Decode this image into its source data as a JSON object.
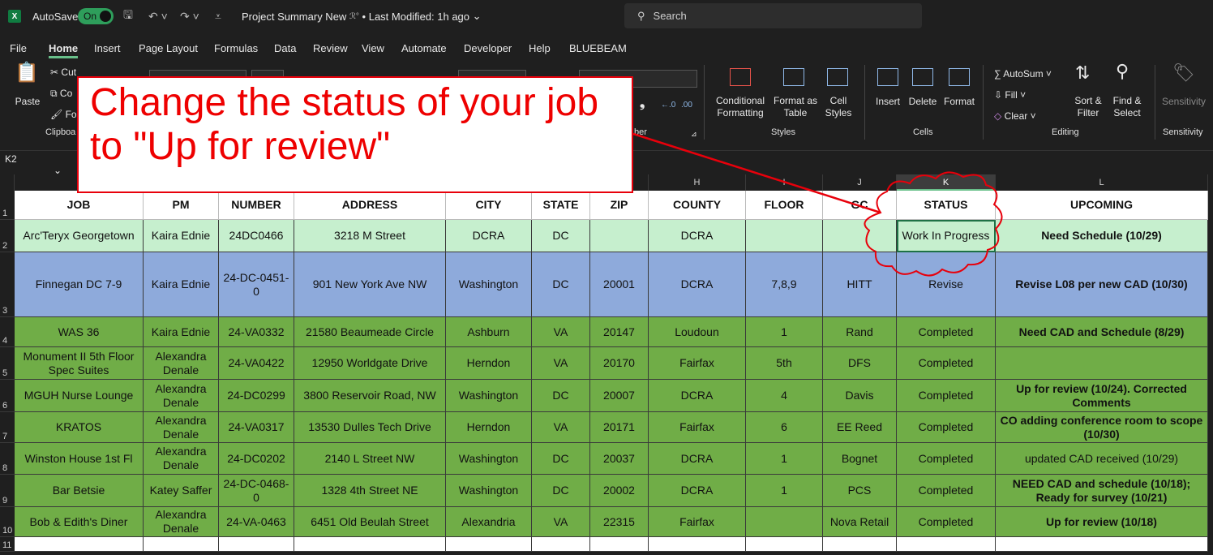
{
  "titlebar": {
    "app_icon": "X",
    "autosave_label": "AutoSave",
    "autosave_state": "On",
    "doc_title": "Project Summary New",
    "doc_meta": "• Last Modified: 1h ago",
    "search_placeholder": "Search"
  },
  "menu": [
    "File",
    "Home",
    "Insert",
    "Page Layout",
    "Formulas",
    "Data",
    "Review",
    "View",
    "Automate",
    "Developer",
    "Help",
    "BLUEBEAM"
  ],
  "ribbon": {
    "clipboard": {
      "paste": "Paste",
      "cut": "Cut",
      "copy": "Co",
      "format": "Fo",
      "group": "Clipboa"
    },
    "number_group": "ber",
    "styles": {
      "conditional": "Conditional\nFormatting",
      "format_table": "Format as\nTable",
      "cell_styles": "Cell\nStyles",
      "group": "Styles"
    },
    "cells": {
      "insert": "Insert",
      "delete": "Delete",
      "format": "Format",
      "group": "Cells"
    },
    "editing": {
      "autosum": "AutoSum",
      "fill": "Fill",
      "clear": "Clear",
      "sort": "Sort &\nFilter",
      "find": "Find &\nSelect",
      "group": "Editing"
    },
    "sensitivity": {
      "label": "Sensitivity",
      "group": "Sensitivity"
    }
  },
  "namebox": "K2",
  "colors": {
    "light_green": "#c6efce",
    "blue": "#8eaadb",
    "green": "#70ad47",
    "header": "#ffffff",
    "accent": "#69c08a",
    "callout_red": "#ee0000"
  },
  "sheet": {
    "col_letters": [
      "",
      "",
      "",
      "",
      "",
      "",
      "",
      "H",
      "I",
      "J",
      "K",
      "L"
    ],
    "headers": [
      "JOB",
      "PM",
      "NUMBER",
      "ADDRESS",
      "CITY",
      "STATE",
      "ZIP",
      "COUNTY",
      "FLOOR",
      "GC",
      "STATUS",
      "UPCOMING"
    ],
    "rows": [
      [
        "Arc'Teryx Georgetown",
        "Kaira Ednie",
        "24DC0466",
        "3218 M Street",
        "DCRA",
        "DC",
        "",
        "DCRA",
        "",
        "",
        "Work In Progress",
        "Need Schedule (10/29)"
      ],
      [
        "Finnegan DC 7-9",
        "Kaira Ednie",
        "24-DC-0451-0",
        "901 New York Ave NW",
        "Washington",
        "DC",
        "20001",
        "DCRA",
        "7,8,9",
        "HITT",
        "Revise",
        "Revise L08 per new CAD (10/30)"
      ],
      [
        "WAS 36",
        "Kaira Ednie",
        "24-VA0332",
        "21580 Beaumeade Circle",
        "Ashburn",
        "VA",
        "20147",
        "Loudoun",
        "1",
        "Rand",
        "Completed",
        "Need CAD and Schedule (8/29)"
      ],
      [
        "Monument II 5th Floor Spec Suites",
        "Alexandra Denale",
        "24-VA0422",
        "12950 Worldgate Drive",
        "Herndon",
        "VA",
        "20170",
        "Fairfax",
        "5th",
        "DFS",
        "Completed",
        ""
      ],
      [
        "MGUH Nurse Lounge",
        "Alexandra Denale",
        "24-DC0299",
        "3800 Reservoir Road, NW",
        "Washington",
        "DC",
        "20007",
        "DCRA",
        "4",
        "Davis",
        "Completed",
        "Up for review (10/24). Corrected Comments"
      ],
      [
        "KRATOS",
        "Alexandra Denale",
        "24-VA0317",
        "13530 Dulles Tech Drive",
        "Herndon",
        "VA",
        "20171",
        "Fairfax",
        "6",
        "EE Reed",
        "Completed",
        "CO adding conference room to scope (10/30)"
      ],
      [
        "Winston House 1st Fl",
        "Alexandra Denale",
        "24-DC0202",
        "2140 L Street NW",
        "Washington",
        "DC",
        "20037",
        "DCRA",
        "1",
        "Bognet",
        "Completed",
        "updated CAD received (10/29)"
      ],
      [
        "Bar Betsie",
        "Katey Saffer",
        "24-DC-0468-0",
        "1328 4th Street NE",
        "Washington",
        "DC",
        "20002",
        "DCRA",
        "1",
        "PCS",
        "Completed",
        "NEED CAD and schedule (10/18); Ready for survey (10/21)"
      ],
      [
        "Bob & Edith's Diner",
        "Alexandra Denale",
        "24-VA-0463",
        "6451 Old Beulah Street",
        "Alexandria",
        "VA",
        "22315",
        "Fairfax",
        "",
        "Nova Retail",
        "Completed",
        "Up for review (10/18)"
      ]
    ],
    "row_numbers": [
      "1",
      "2",
      "3",
      "4",
      "5",
      "6",
      "7",
      "8",
      "9",
      "10",
      "11"
    ]
  },
  "callout": {
    "text": "Change the status of your job to \"Up for review\""
  }
}
